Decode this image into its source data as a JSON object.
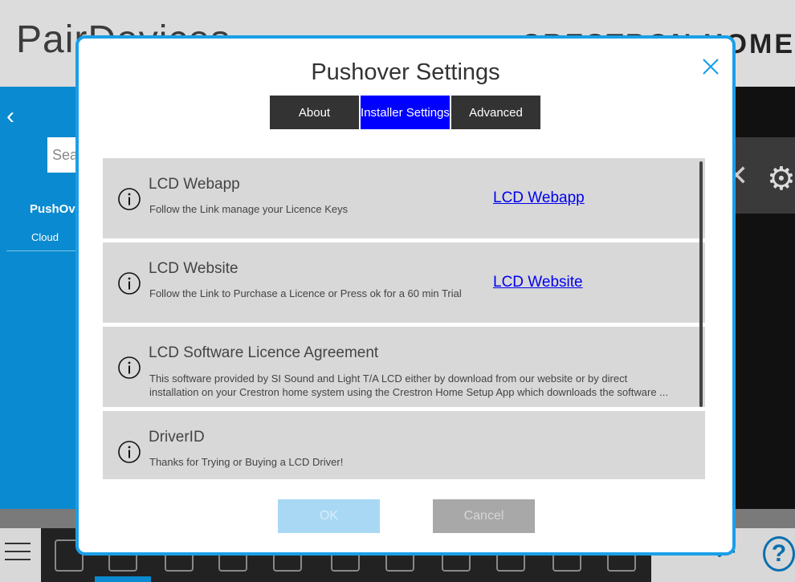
{
  "background": {
    "title": "PairDevices",
    "brand": "CRESTRON HOME",
    "search_placeholder": "Search",
    "device_name": "PushOver",
    "device_type": "Cloud"
  },
  "modal": {
    "title": "Pushover Settings",
    "tabs": [
      {
        "label": "About",
        "active": false
      },
      {
        "label": "Installer Settings",
        "active": true
      },
      {
        "label": "Advanced",
        "active": false
      }
    ],
    "rows": [
      {
        "title": "LCD Webapp",
        "description": "Follow the Link manage your Licence Keys",
        "link": "LCD Webapp"
      },
      {
        "title": "LCD Website",
        "description": "Follow the Link to Purchase a Licence or Press ok for a 60 min Trial",
        "link": "LCD Website"
      },
      {
        "title": "LCD Software Licence Agreement",
        "description": "This software provided by SI Sound and Light T/A LCD either by download from our website or by direct installation on your Crestron home system using the Crestron Home Setup App which downloads the software ..."
      },
      {
        "title": "DriverID",
        "description": "Thanks for Trying or Buying a LCD Driver!"
      }
    ],
    "ok_label": "OK",
    "cancel_label": "Cancel"
  },
  "colors": {
    "accent": "#1a9fe8",
    "active_tab": "#0000ff",
    "tab_bg": "#333333",
    "row_bg": "#d8d8d8",
    "link": "#0000ee"
  }
}
